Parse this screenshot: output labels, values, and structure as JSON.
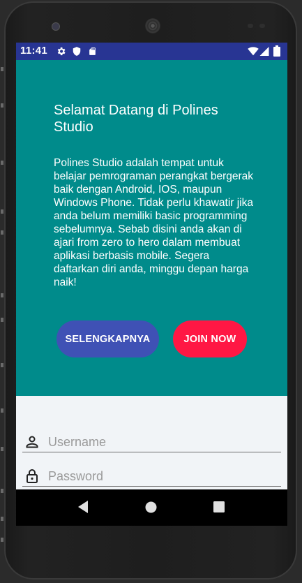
{
  "status_bar": {
    "time": "11:41",
    "left_icons": [
      "gear-icon",
      "shield-icon",
      "sd-card-icon"
    ],
    "right_icons": [
      "wifi-icon",
      "signal-icon",
      "battery-icon"
    ],
    "background": "#283593"
  },
  "hero": {
    "title": "Selamat Datang di Polines Studio",
    "description": "Polines Studio adalah tempat untuk belajar pemrograman perangkat bergerak baik dengan Android, IOS, maupun Windows Phone. Tidak perlu khawatir jika anda belum memiliki basic programming sebelumnya. Sebab disini anda akan di ajari from zero to hero dalam membuat aplikasi berbasis mobile. Segera daftarkan diri anda, minggu depan harga naik!",
    "background": "#008b8b",
    "more_button_label": "SELENGKAPNYA",
    "join_button_label": "JOIN NOW",
    "more_button_color": "#3f51b5",
    "join_button_color": "#ff1744"
  },
  "form": {
    "username": {
      "placeholder": "Username",
      "value": "",
      "icon": "person-icon"
    },
    "password": {
      "placeholder": "Password",
      "value": "",
      "icon": "lock-icon"
    }
  },
  "nav_bar": {
    "buttons": [
      "back-icon",
      "home-icon",
      "recents-icon"
    ]
  }
}
